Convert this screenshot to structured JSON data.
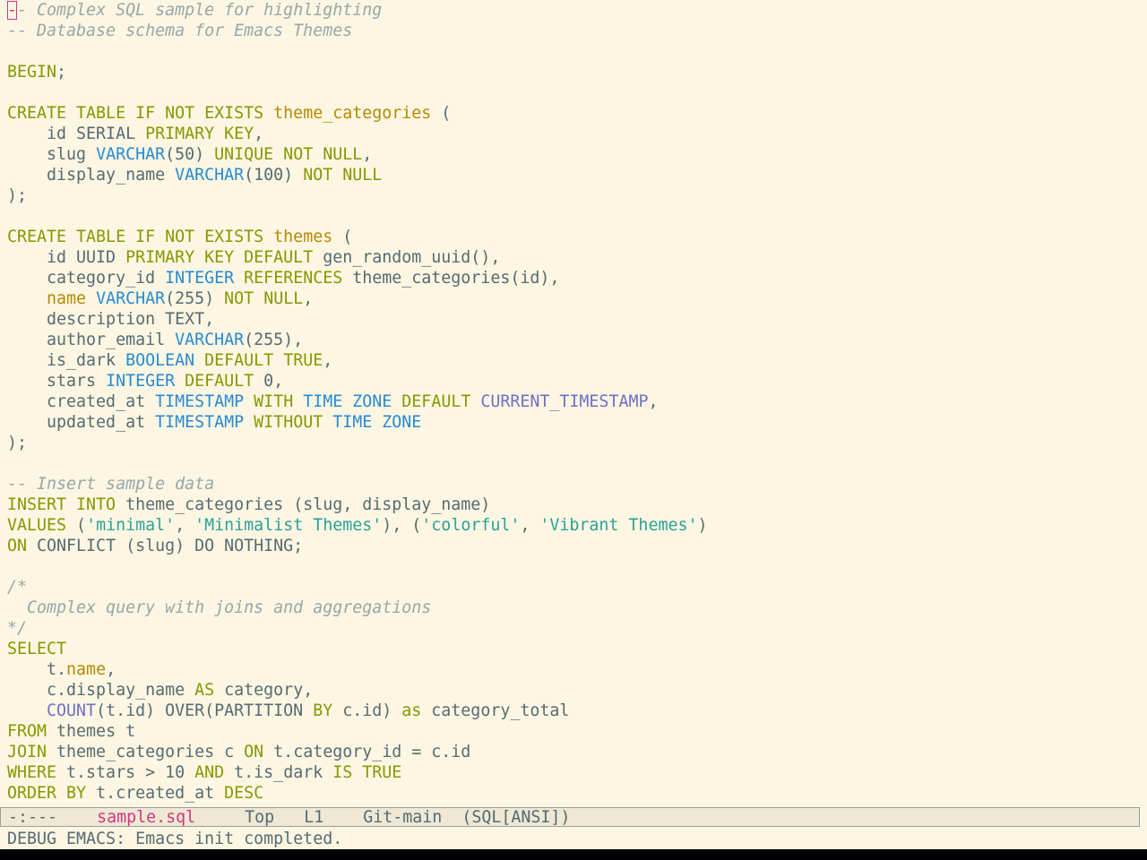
{
  "editor": {
    "lines": [
      [
        [
          "cursor",
          "-"
        ],
        [
          "comment",
          "- Complex SQL sample for highlighting"
        ]
      ],
      [
        [
          "comment",
          "-- Database schema for Emacs Themes"
        ]
      ],
      [],
      [
        [
          "kw",
          "BEGIN"
        ],
        [
          "plain",
          ";"
        ]
      ],
      [],
      [
        [
          "kw",
          "CREATE TABLE IF NOT EXISTS "
        ],
        [
          "name",
          "theme_categories"
        ],
        [
          "plain",
          " ("
        ]
      ],
      [
        [
          "plain",
          "    id SERIAL "
        ],
        [
          "kw",
          "PRIMARY KEY"
        ],
        [
          "plain",
          ","
        ]
      ],
      [
        [
          "plain",
          "    slug "
        ],
        [
          "type",
          "VARCHAR"
        ],
        [
          "plain",
          "(50) "
        ],
        [
          "kw",
          "UNIQUE NOT NULL"
        ],
        [
          "plain",
          ","
        ]
      ],
      [
        [
          "plain",
          "    display_name "
        ],
        [
          "type",
          "VARCHAR"
        ],
        [
          "plain",
          "(100) "
        ],
        [
          "kw",
          "NOT NULL"
        ]
      ],
      [
        [
          "plain",
          ");"
        ]
      ],
      [],
      [
        [
          "kw",
          "CREATE TABLE IF NOT EXISTS "
        ],
        [
          "name",
          "themes"
        ],
        [
          "plain",
          " ("
        ]
      ],
      [
        [
          "plain",
          "    id UUID "
        ],
        [
          "kw",
          "PRIMARY KEY DEFAULT"
        ],
        [
          "plain",
          " gen_random_uuid(),"
        ]
      ],
      [
        [
          "plain",
          "    category_id "
        ],
        [
          "type",
          "INTEGER"
        ],
        [
          "plain",
          " "
        ],
        [
          "kw",
          "REFERENCES"
        ],
        [
          "plain",
          " theme_categories(id),"
        ]
      ],
      [
        [
          "plain",
          "    "
        ],
        [
          "name",
          "name"
        ],
        [
          "plain",
          " "
        ],
        [
          "type",
          "VARCHAR"
        ],
        [
          "plain",
          "(255) "
        ],
        [
          "kw",
          "NOT NULL"
        ],
        [
          "plain",
          ","
        ]
      ],
      [
        [
          "plain",
          "    description TEXT,"
        ]
      ],
      [
        [
          "plain",
          "    author_email "
        ],
        [
          "type",
          "VARCHAR"
        ],
        [
          "plain",
          "(255),"
        ]
      ],
      [
        [
          "plain",
          "    is_dark "
        ],
        [
          "type",
          "BOOLEAN"
        ],
        [
          "plain",
          " "
        ],
        [
          "kw",
          "DEFAULT TRUE"
        ],
        [
          "plain",
          ","
        ]
      ],
      [
        [
          "plain",
          "    stars "
        ],
        [
          "type",
          "INTEGER"
        ],
        [
          "plain",
          " "
        ],
        [
          "kw",
          "DEFAULT"
        ],
        [
          "plain",
          " 0,"
        ]
      ],
      [
        [
          "plain",
          "    created_at "
        ],
        [
          "type",
          "TIMESTAMP"
        ],
        [
          "plain",
          " "
        ],
        [
          "kw",
          "WITH"
        ],
        [
          "plain",
          " "
        ],
        [
          "type",
          "TIME ZONE"
        ],
        [
          "plain",
          " "
        ],
        [
          "kw",
          "DEFAULT"
        ],
        [
          "plain",
          " "
        ],
        [
          "fn",
          "CURRENT_TIMESTAMP"
        ],
        [
          "plain",
          ","
        ]
      ],
      [
        [
          "plain",
          "    updated_at "
        ],
        [
          "type",
          "TIMESTAMP"
        ],
        [
          "plain",
          " "
        ],
        [
          "kw",
          "WITHOUT"
        ],
        [
          "plain",
          " "
        ],
        [
          "type",
          "TIME ZONE"
        ]
      ],
      [
        [
          "plain",
          ");"
        ]
      ],
      [],
      [
        [
          "comment",
          "-- Insert sample data"
        ]
      ],
      [
        [
          "kw",
          "INSERT INTO"
        ],
        [
          "plain",
          " theme_categories (slug, display_name)"
        ]
      ],
      [
        [
          "kw",
          "VALUES"
        ],
        [
          "plain",
          " ("
        ],
        [
          "str",
          "'minimal'"
        ],
        [
          "plain",
          ", "
        ],
        [
          "str",
          "'Minimalist Themes'"
        ],
        [
          "plain",
          "), ("
        ],
        [
          "str",
          "'colorful'"
        ],
        [
          "plain",
          ", "
        ],
        [
          "str",
          "'Vibrant Themes'"
        ],
        [
          "plain",
          ")"
        ]
      ],
      [
        [
          "kw",
          "ON"
        ],
        [
          "plain",
          " CONFLICT (slug) DO NOTHING;"
        ]
      ],
      [],
      [
        [
          "comment",
          "/*"
        ]
      ],
      [
        [
          "comment",
          "  Complex query with joins and aggregations"
        ]
      ],
      [
        [
          "comment",
          "*/"
        ]
      ],
      [
        [
          "kw",
          "SELECT"
        ]
      ],
      [
        [
          "plain",
          "    t."
        ],
        [
          "name",
          "name"
        ],
        [
          "plain",
          ","
        ]
      ],
      [
        [
          "plain",
          "    c.display_name "
        ],
        [
          "kw",
          "AS"
        ],
        [
          "plain",
          " category,"
        ]
      ],
      [
        [
          "plain",
          "    "
        ],
        [
          "fn",
          "COUNT"
        ],
        [
          "plain",
          "(t.id) OVER(PARTITION "
        ],
        [
          "kw",
          "BY"
        ],
        [
          "plain",
          " c.id) "
        ],
        [
          "kw",
          "as"
        ],
        [
          "plain",
          " category_total"
        ]
      ],
      [
        [
          "kw",
          "FROM"
        ],
        [
          "plain",
          " themes t"
        ]
      ],
      [
        [
          "kw",
          "JOIN"
        ],
        [
          "plain",
          " theme_categories c "
        ],
        [
          "kw",
          "ON"
        ],
        [
          "plain",
          " t.category_id = c.id"
        ]
      ],
      [
        [
          "kw",
          "WHERE"
        ],
        [
          "plain",
          " t.stars > 10 "
        ],
        [
          "kw",
          "AND"
        ],
        [
          "plain",
          " t.is_dark "
        ],
        [
          "kw",
          "IS TRUE"
        ]
      ],
      [
        [
          "kw",
          "ORDER BY"
        ],
        [
          "plain",
          " t.created_at "
        ],
        [
          "kw",
          "DESC"
        ]
      ]
    ]
  },
  "modeline": {
    "state": "-:---",
    "buffer": "sample.sql",
    "position": "Top",
    "line": "L1",
    "vc": "Git-main",
    "mode": "(SQL[ANSI])"
  },
  "echo": {
    "message": "DEBUG EMACS: Emacs init completed."
  }
}
